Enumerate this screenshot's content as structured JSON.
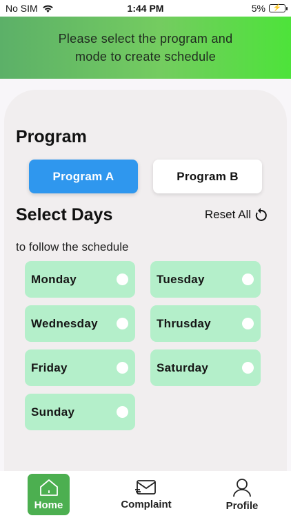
{
  "status_bar": {
    "carrier": "No SIM",
    "time": "1:44 PM",
    "battery": "5%"
  },
  "header": {
    "message": "Please select the program and mode to create schedule"
  },
  "program": {
    "title": "Program",
    "options": [
      {
        "label": "Program A",
        "selected": true
      },
      {
        "label": "Program B",
        "selected": false
      }
    ]
  },
  "days": {
    "title": "Select Days",
    "reset_label": "Reset All",
    "subtitle": "to follow the schedule",
    "items": [
      {
        "label": "Monday"
      },
      {
        "label": "Tuesday"
      },
      {
        "label": "Wednesday"
      },
      {
        "label": "Thrusday"
      },
      {
        "label": "Friday"
      },
      {
        "label": "Saturday"
      },
      {
        "label": "Sunday"
      }
    ]
  },
  "nav": {
    "items": [
      {
        "label": "Home",
        "icon": "home-icon",
        "active": true
      },
      {
        "label": "Complaint",
        "icon": "mail-icon",
        "active": false
      },
      {
        "label": "Profile",
        "icon": "person-icon",
        "active": false
      }
    ]
  },
  "colors": {
    "selected_program": "#2f97ee",
    "day_chip": "#b4efca",
    "active_nav": "#4caf50"
  }
}
